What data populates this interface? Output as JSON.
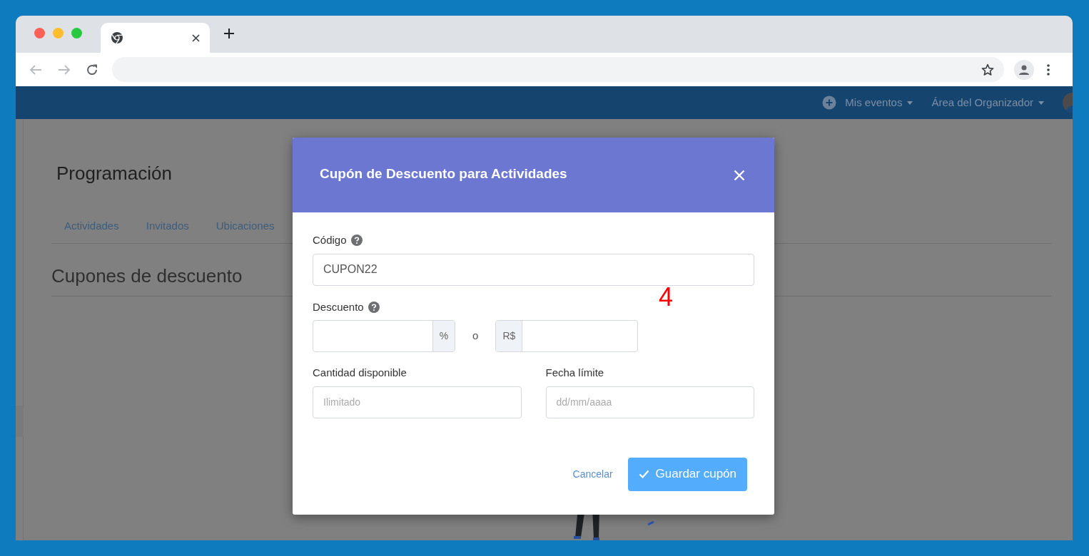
{
  "navbar": {
    "items": [
      {
        "label": "Mis eventos"
      },
      {
        "label": "Área del Organizador"
      }
    ]
  },
  "page": {
    "title": "Programación",
    "tabs": [
      {
        "label": "Actividades"
      },
      {
        "label": "Invitados"
      },
      {
        "label": "Ubicaciones"
      }
    ],
    "section_title": "Cupones de descuento"
  },
  "modal": {
    "title": "Cupón de Descuento para Actividades",
    "code": {
      "label": "Código",
      "value": "CUPON22"
    },
    "discount": {
      "label": "Descuento",
      "percent_unit": "%",
      "separator": "o",
      "currency_unit": "R$"
    },
    "quantity": {
      "label": "Cantidad disponible",
      "placeholder": "Ilimitado"
    },
    "deadline": {
      "label": "Fecha límite",
      "placeholder": "dd/mm/aaaa"
    },
    "cancel": "Cancelar",
    "save": "Guardar cupón"
  },
  "annotation": "4"
}
